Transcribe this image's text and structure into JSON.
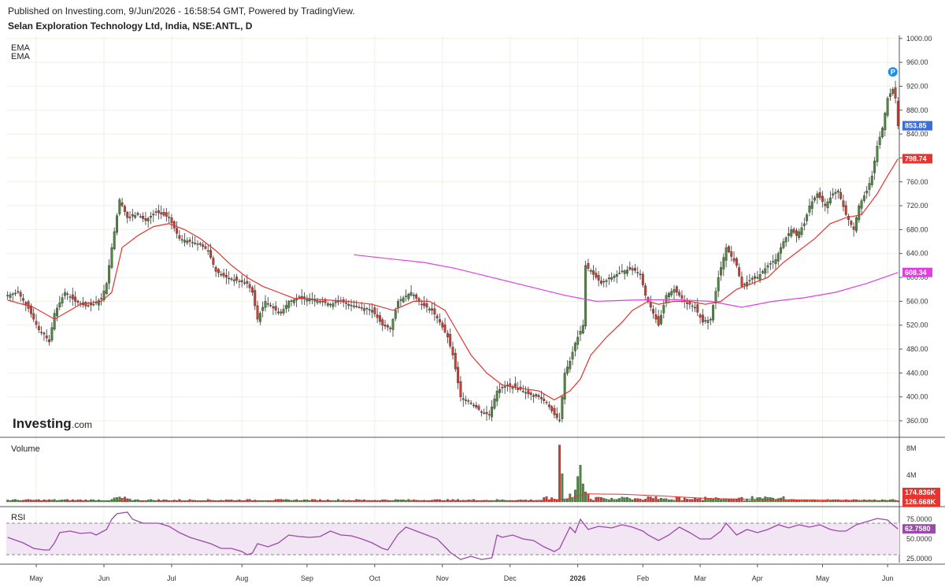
{
  "header": {
    "published": "Published on Investing.com, 9/Jun/2026 - 16:58:54 GMT, Powered by TradingView.",
    "symbol": "Selan Exploration Technology Ltd, India, NSE:ANTL, D"
  },
  "legend": {
    "ema1": "EMA",
    "ema2": "EMA"
  },
  "logo": {
    "main": "Investing",
    "sub": ".com"
  },
  "colors": {
    "up": "#4e8a3e",
    "down": "#d43a2f",
    "ema_fast": "#e8332e",
    "ema_slow": "#e040e0",
    "last_price": "#3b6fd6",
    "rsi": "#9a4aa8",
    "rsi_band": "#f2e6f4"
  },
  "chart_data": [
    {
      "type": "candlestick",
      "title": "Selan Exploration Technology Ltd, India, NSE:ANTL, D",
      "ylim": [
        335,
        1005
      ],
      "y_ticks": [
        360,
        400,
        440,
        480,
        520,
        560,
        600,
        640,
        680,
        720,
        760,
        800,
        840,
        880,
        920,
        960,
        1000
      ],
      "y_tick_labels": [
        "360.00",
        "400.00",
        "440.00",
        "480.00",
        "520.00",
        "560.00",
        "600.00",
        "640.00",
        "680.00",
        "720.00",
        "760.00",
        "800.00",
        "840.00",
        "880.00",
        "920.00",
        "960.00",
        "1000.00"
      ],
      "x_labels": [
        "May",
        "Jun",
        "Jul",
        "Aug",
        "Sep",
        "Oct",
        "Nov",
        "Dec",
        "2026",
        "Feb",
        "Mar",
        "Apr",
        "May",
        "Jun"
      ],
      "close_path": [
        [
          0,
          570
        ],
        [
          4,
          575
        ],
        [
          8,
          548
        ],
        [
          12,
          512
        ],
        [
          14,
          505
        ],
        [
          16,
          492
        ],
        [
          18,
          540
        ],
        [
          22,
          575
        ],
        [
          26,
          560
        ],
        [
          30,
          552
        ],
        [
          33,
          555
        ],
        [
          36,
          565
        ],
        [
          38,
          590
        ],
        [
          40,
          650
        ],
        [
          43,
          730
        ],
        [
          46,
          700
        ],
        [
          50,
          705
        ],
        [
          53,
          695
        ],
        [
          57,
          710
        ],
        [
          62,
          700
        ],
        [
          66,
          665
        ],
        [
          70,
          660
        ],
        [
          74,
          655
        ],
        [
          77,
          645
        ],
        [
          80,
          610
        ],
        [
          84,
          600
        ],
        [
          88,
          595
        ],
        [
          92,
          590
        ],
        [
          94,
          575
        ],
        [
          96,
          530
        ],
        [
          99,
          560
        ],
        [
          103,
          545
        ],
        [
          105,
          540
        ],
        [
          108,
          560
        ],
        [
          112,
          565
        ],
        [
          116,
          565
        ],
        [
          120,
          560
        ],
        [
          124,
          555
        ],
        [
          128,
          560
        ],
        [
          131,
          555
        ],
        [
          135,
          550
        ],
        [
          140,
          545
        ],
        [
          144,
          520
        ],
        [
          147,
          515
        ],
        [
          150,
          560
        ],
        [
          155,
          575
        ],
        [
          159,
          555
        ],
        [
          163,
          545
        ],
        [
          166,
          525
        ],
        [
          169,
          500
        ],
        [
          171,
          470
        ],
        [
          174,
          400
        ],
        [
          178,
          390
        ],
        [
          182,
          375
        ],
        [
          185,
          370
        ],
        [
          188,
          410
        ],
        [
          192,
          420
        ],
        [
          196,
          415
        ],
        [
          200,
          405
        ],
        [
          204,
          400
        ],
        [
          207,
          390
        ],
        [
          210,
          370
        ],
        [
          212,
          360
        ],
        [
          214,
          440
        ],
        [
          216,
          460
        ],
        [
          218,
          490
        ],
        [
          221,
          520
        ],
        [
          222,
          620
        ],
        [
          224,
          610
        ],
        [
          228,
          590
        ],
        [
          232,
          600
        ],
        [
          236,
          610
        ],
        [
          240,
          615
        ],
        [
          243,
          605
        ],
        [
          245,
          570
        ],
        [
          248,
          540
        ],
        [
          250,
          520
        ],
        [
          253,
          570
        ],
        [
          256,
          580
        ],
        [
          260,
          560
        ],
        [
          264,
          550
        ],
        [
          267,
          525
        ],
        [
          270,
          530
        ],
        [
          273,
          600
        ],
        [
          276,
          650
        ],
        [
          280,
          620
        ],
        [
          282,
          585
        ],
        [
          285,
          595
        ],
        [
          288,
          600
        ],
        [
          292,
          620
        ],
        [
          295,
          630
        ],
        [
          298,
          660
        ],
        [
          301,
          680
        ],
        [
          303,
          670
        ],
        [
          306,
          690
        ],
        [
          308,
          720
        ],
        [
          311,
          740
        ],
        [
          314,
          720
        ],
        [
          317,
          740
        ],
        [
          319,
          745
        ],
        [
          322,
          705
        ],
        [
          325,
          680
        ],
        [
          327,
          720
        ],
        [
          330,
          745
        ],
        [
          332,
          770
        ],
        [
          334,
          820
        ],
        [
          336,
          850
        ],
        [
          338,
          900
        ],
        [
          340,
          915
        ],
        [
          341,
          900
        ],
        [
          342,
          853.85
        ]
      ],
      "ema_fast": {
        "last": 798.74,
        "path": [
          [
            0,
            562
          ],
          [
            10,
            550
          ],
          [
            18,
            530
          ],
          [
            28,
            555
          ],
          [
            36,
            560
          ],
          [
            40,
            575
          ],
          [
            44,
            650
          ],
          [
            50,
            670
          ],
          [
            56,
            685
          ],
          [
            62,
            690
          ],
          [
            68,
            680
          ],
          [
            74,
            665
          ],
          [
            80,
            645
          ],
          [
            86,
            620
          ],
          [
            92,
            600
          ],
          [
            98,
            585
          ],
          [
            104,
            575
          ],
          [
            110,
            565
          ],
          [
            120,
            563
          ],
          [
            130,
            560
          ],
          [
            140,
            555
          ],
          [
            148,
            545
          ],
          [
            156,
            560
          ],
          [
            162,
            560
          ],
          [
            168,
            545
          ],
          [
            172,
            515
          ],
          [
            178,
            470
          ],
          [
            184,
            440
          ],
          [
            190,
            420
          ],
          [
            196,
            415
          ],
          [
            204,
            410
          ],
          [
            210,
            395
          ],
          [
            216,
            410
          ],
          [
            220,
            430
          ],
          [
            224,
            470
          ],
          [
            230,
            500
          ],
          [
            236,
            525
          ],
          [
            240,
            545
          ],
          [
            246,
            560
          ],
          [
            250,
            555
          ],
          [
            256,
            560
          ],
          [
            262,
            560
          ],
          [
            268,
            555
          ],
          [
            274,
            560
          ],
          [
            280,
            580
          ],
          [
            286,
            590
          ],
          [
            292,
            600
          ],
          [
            298,
            625
          ],
          [
            304,
            645
          ],
          [
            310,
            665
          ],
          [
            316,
            690
          ],
          [
            322,
            700
          ],
          [
            328,
            705
          ],
          [
            334,
            740
          ],
          [
            338,
            770
          ],
          [
            342,
            798.74
          ]
        ]
      },
      "ema_slow": {
        "last": 608.34,
        "path": [
          [
            133,
            638
          ],
          [
            145,
            632
          ],
          [
            160,
            625
          ],
          [
            172,
            615
          ],
          [
            186,
            600
          ],
          [
            200,
            585
          ],
          [
            214,
            570
          ],
          [
            226,
            560
          ],
          [
            240,
            562
          ],
          [
            256,
            563
          ],
          [
            270,
            560
          ],
          [
            282,
            550
          ],
          [
            294,
            560
          ],
          [
            306,
            566
          ],
          [
            318,
            575
          ],
          [
            330,
            590
          ],
          [
            342,
            608.34
          ]
        ]
      },
      "last_price": 853.85,
      "marker": "P"
    },
    {
      "type": "bar",
      "title": "Volume",
      "y_tick_labels": [
        "4M",
        "8M"
      ],
      "y_ticks": [
        4000000,
        8000000
      ],
      "spikes": [
        [
          212,
          8500000
        ],
        [
          213,
          4200000
        ],
        [
          216,
          1200000
        ],
        [
          218,
          1800000
        ],
        [
          219,
          3800000
        ],
        [
          220,
          5500000
        ],
        [
          221,
          2700000
        ],
        [
          222,
          1500000
        ],
        [
          223,
          1100000
        ]
      ],
      "volume_ma_last": 174836,
      "last_volume": 126668,
      "value_labels": [
        "174.836K",
        "126.668K"
      ]
    },
    {
      "type": "line",
      "title": "RSI",
      "ylim": [
        20,
        88
      ],
      "y_tick_labels": [
        "75.0000",
        "50.0000",
        "25.0000"
      ],
      "y_ticks": [
        75,
        50,
        25
      ],
      "bands": [
        70,
        30
      ],
      "last": 62.758,
      "last_label": "62.7580",
      "path": [
        [
          0,
          52
        ],
        [
          6,
          45
        ],
        [
          10,
          38
        ],
        [
          14,
          36
        ],
        [
          16,
          36
        ],
        [
          18,
          45
        ],
        [
          20,
          58
        ],
        [
          24,
          60
        ],
        [
          28,
          57
        ],
        [
          32,
          58
        ],
        [
          34,
          55
        ],
        [
          38,
          62
        ],
        [
          40,
          75
        ],
        [
          42,
          82
        ],
        [
          46,
          84
        ],
        [
          48,
          75
        ],
        [
          52,
          70
        ],
        [
          58,
          70
        ],
        [
          62,
          66
        ],
        [
          66,
          58
        ],
        [
          70,
          52
        ],
        [
          74,
          48
        ],
        [
          78,
          44
        ],
        [
          82,
          38
        ],
        [
          86,
          38
        ],
        [
          90,
          34
        ],
        [
          92,
          30
        ],
        [
          94,
          32
        ],
        [
          96,
          44
        ],
        [
          100,
          40
        ],
        [
          104,
          45
        ],
        [
          108,
          55
        ],
        [
          112,
          53
        ],
        [
          116,
          52
        ],
        [
          120,
          53
        ],
        [
          124,
          60
        ],
        [
          128,
          55
        ],
        [
          132,
          54
        ],
        [
          136,
          50
        ],
        [
          140,
          45
        ],
        [
          144,
          38
        ],
        [
          146,
          36
        ],
        [
          150,
          56
        ],
        [
          153,
          65
        ],
        [
          157,
          60
        ],
        [
          161,
          55
        ],
        [
          165,
          50
        ],
        [
          168,
          40
        ],
        [
          170,
          33
        ],
        [
          174,
          24
        ],
        [
          178,
          28
        ],
        [
          182,
          24
        ],
        [
          186,
          26
        ],
        [
          188,
          55
        ],
        [
          190,
          52
        ],
        [
          194,
          55
        ],
        [
          198,
          50
        ],
        [
          202,
          48
        ],
        [
          206,
          40
        ],
        [
          210,
          34
        ],
        [
          212,
          38
        ],
        [
          216,
          65
        ],
        [
          218,
          58
        ],
        [
          220,
          75
        ],
        [
          223,
          62
        ],
        [
          227,
          66
        ],
        [
          232,
          64
        ],
        [
          236,
          68
        ],
        [
          240,
          65
        ],
        [
          244,
          60
        ],
        [
          246,
          55
        ],
        [
          250,
          48
        ],
        [
          254,
          55
        ],
        [
          258,
          65
        ],
        [
          262,
          58
        ],
        [
          266,
          50
        ],
        [
          270,
          50
        ],
        [
          274,
          60
        ],
        [
          276,
          70
        ],
        [
          280,
          55
        ],
        [
          284,
          62
        ],
        [
          288,
          58
        ],
        [
          292,
          62
        ],
        [
          296,
          68
        ],
        [
          300,
          64
        ],
        [
          304,
          68
        ],
        [
          308,
          65
        ],
        [
          312,
          68
        ],
        [
          316,
          62
        ],
        [
          319,
          60
        ],
        [
          322,
          60
        ],
        [
          326,
          68
        ],
        [
          330,
          72
        ],
        [
          334,
          76
        ],
        [
          338,
          74
        ],
        [
          340,
          68
        ],
        [
          342,
          62.758
        ]
      ]
    }
  ]
}
